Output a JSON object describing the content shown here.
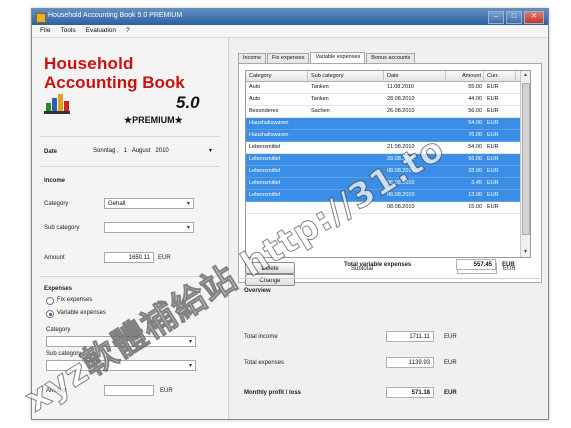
{
  "window": {
    "title": "Household Accounting Book 5.0 PREMIUM"
  },
  "titlebar_buttons": {
    "minimize": "–",
    "maximize": "□",
    "close": "✕"
  },
  "menu": [
    "File",
    "Tools",
    "Evaluation",
    "?"
  ],
  "logo": {
    "line1": "Household",
    "line2": "Accounting Book",
    "version": "5.0",
    "edition": "★PREMIUM★"
  },
  "date": {
    "label": "Date",
    "weekday": "Sonntag",
    "day": "1",
    "month": "August",
    "year": "2010"
  },
  "income": {
    "header": "Income",
    "category_label": "Category",
    "category_value": "Gehalt",
    "subcategory_label": "Sub category",
    "subcategory_value": "",
    "amount_label": "Amount",
    "amount_value": "1650.11",
    "currency": "EUR"
  },
  "expenses": {
    "header": "Expenses",
    "fix_label": "Fix expenses",
    "variable_label": "Variable expenses",
    "category_label": "Category",
    "category_value": "",
    "subcategory_label": "Sub category",
    "subcategory_value": "",
    "amount_label": "Amount",
    "amount_value": "",
    "currency": "EUR"
  },
  "tabs": [
    "Income",
    "Fix expenses",
    "Variable expenses",
    "Bonus accounts"
  ],
  "table": {
    "columns": [
      "Category",
      "Sub category",
      "Date",
      "Amount",
      "Curr."
    ],
    "rows": [
      {
        "category": "Auto",
        "sub": "Tanken",
        "date": "11.08.2010",
        "amount": "55.00",
        "curr": "EUR",
        "selected": false
      },
      {
        "category": "Auto",
        "sub": "Tanken",
        "date": "28.08.2010",
        "amount": "44.00",
        "curr": "EUR",
        "selected": false
      },
      {
        "category": "Besonderes",
        "sub": "Sachen",
        "date": "26.08.2010",
        "amount": "56.00",
        "curr": "EUR",
        "selected": false
      },
      {
        "category": "Haushaltswaren",
        "sub": "",
        "date": "",
        "amount": "54.00",
        "curr": "EUR",
        "selected": true
      },
      {
        "category": "Haushaltswaren",
        "sub": "",
        "date": "",
        "amount": "76.00",
        "curr": "EUR",
        "selected": true
      },
      {
        "category": "Lebensmittel",
        "sub": "",
        "date": "21.08.2010",
        "amount": "54.00",
        "curr": "EUR",
        "selected": false
      },
      {
        "category": "Lebensmittel",
        "sub": "",
        "date": "28.08.2010",
        "amount": "56.00",
        "curr": "EUR",
        "selected": true
      },
      {
        "category": "Lebensmittel",
        "sub": "",
        "date": "08.08.2010",
        "amount": "28.00",
        "curr": "EUR",
        "selected": true
      },
      {
        "category": "Lebensmittel",
        "sub": "",
        "date": "06.08.2010",
        "amount": "3.45",
        "curr": "EUR",
        "selected": true
      },
      {
        "category": "Lebensmittel",
        "sub": "",
        "date": "06.08.2010",
        "amount": "13.00",
        "curr": "EUR",
        "selected": true
      },
      {
        "category": "",
        "sub": "",
        "date": "08.08.2010",
        "amount": "15.00",
        "curr": "EUR",
        "selected": false
      }
    ]
  },
  "buttons": {
    "delete": "Delete",
    "change": "Change"
  },
  "subtotal": {
    "label": "Subtotal",
    "value": "223.45",
    "currency": "EUR"
  },
  "total_variable": {
    "label": "Total variable expenses",
    "value": "557.45",
    "currency": "EUR"
  },
  "overview": {
    "header": "Overview",
    "total_income_label": "Total income",
    "total_income_value": "1711.11",
    "total_expenses_label": "Total expenses",
    "total_expenses_value": "1139.93",
    "profit_label": "Monthly profit / loss",
    "profit_value": "571.18",
    "currency": "EUR"
  },
  "watermark": "xyz軟體補給站 http://31.to",
  "colors": {
    "accent": "#3a8ee6",
    "logo_red": "#cc1111",
    "titlebar": "#2c5fa0"
  }
}
